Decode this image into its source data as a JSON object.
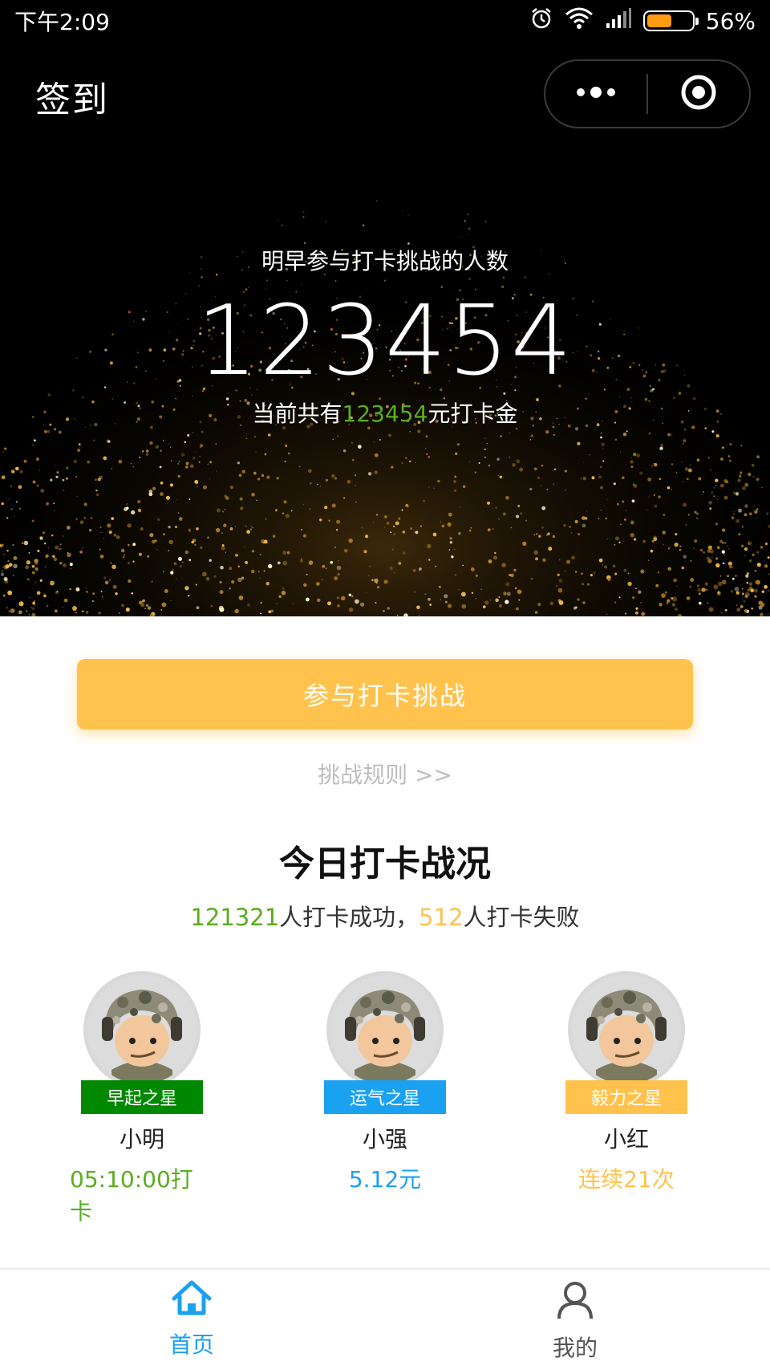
{
  "status_bar": {
    "time": "下午2:09",
    "battery_percent": "56%",
    "battery_level": 0.56
  },
  "nav": {
    "title": "签到",
    "more_icon": "more-dots-icon",
    "close_icon": "target-circle-icon"
  },
  "hero": {
    "subtitle": "明早参与打卡挑战的人数",
    "count": "123454",
    "money_prefix": "当前共有",
    "money_amount": "123454",
    "money_suffix": "元打卡金"
  },
  "main": {
    "join_button": "参与打卡挑战",
    "rules_link": "挑战规则 >>",
    "section_title": "今日打卡战况",
    "success_count": "121321",
    "success_text": "人打卡成功，",
    "fail_count": "512",
    "fail_text": "人打卡失败"
  },
  "stars": [
    {
      "badge": "早起之星",
      "name": "小明",
      "value": "05:10:00打卡",
      "badge_color": "#008800",
      "value_color": "#5aad1e"
    },
    {
      "badge": "运气之星",
      "name": "小强",
      "value": "5.12元",
      "badge_color": "#1aa1f0",
      "value_color": "#1aa1f0"
    },
    {
      "badge": "毅力之星",
      "name": "小红",
      "value": "连续21次",
      "badge_color": "#ffc24c",
      "value_color": "#ffc24c"
    }
  ],
  "tabbar": {
    "home_label": "首页",
    "mine_label": "我的",
    "active_color": "#1aa1f0",
    "inactive_color": "#555555"
  }
}
